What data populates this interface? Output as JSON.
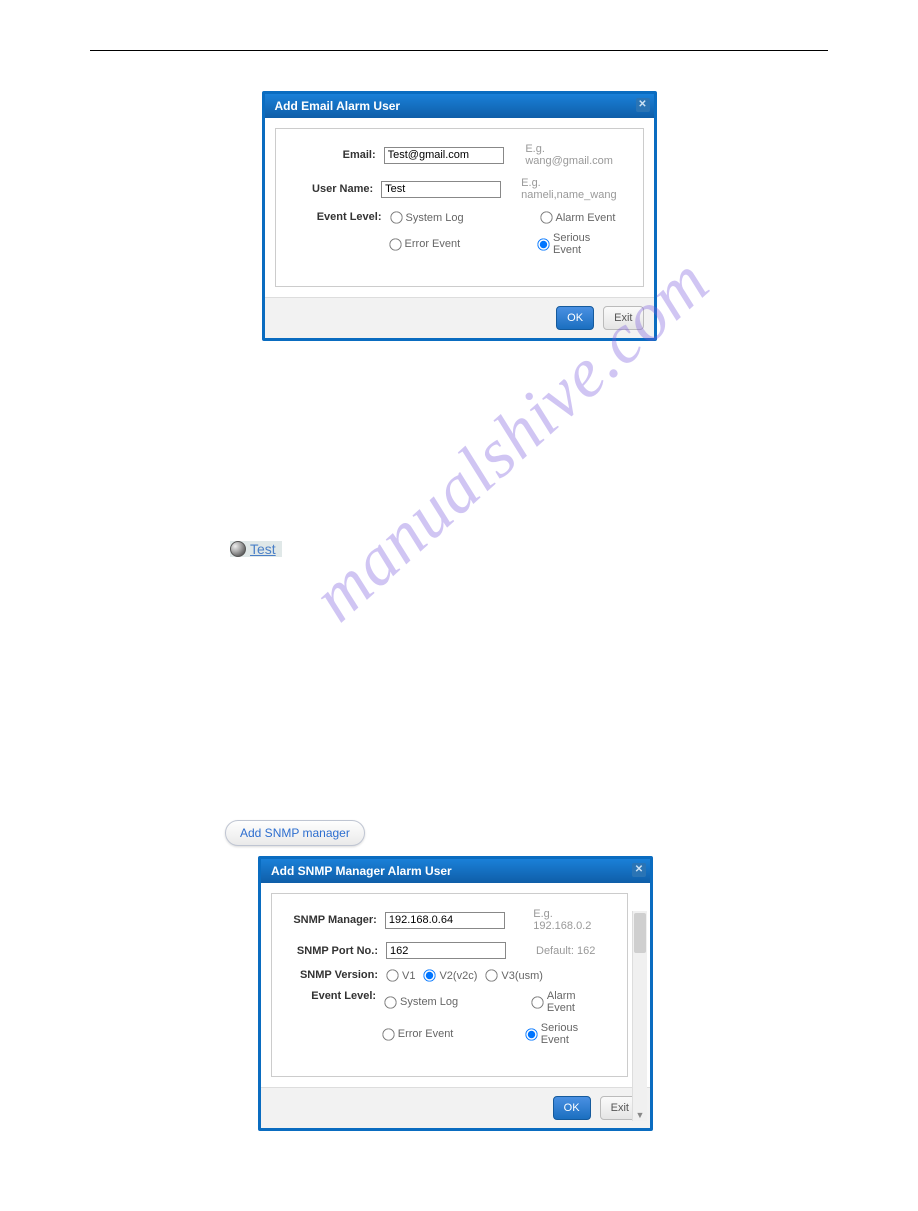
{
  "watermark": "manualshive.com",
  "dialog1": {
    "title": "Add Email Alarm User",
    "email_label": "Email:",
    "email_value": "Test@gmail.com",
    "email_hint": "E.g. wang@gmail.com",
    "username_label": "User Name:",
    "username_value": "Test",
    "username_hint": "E.g. nameli,name_wang",
    "event_label": "Event Level:",
    "opt_systemlog": "System Log",
    "opt_alarm": "Alarm Event",
    "opt_error": "Error Event",
    "opt_serious": "Serious Event",
    "ok": "OK",
    "exit": "Exit"
  },
  "test_link": "Test",
  "pill_button": "Add SNMP manager",
  "dialog2": {
    "title": "Add SNMP Manager Alarm User",
    "manager_label": "SNMP Manager:",
    "manager_value": "192.168.0.64",
    "manager_hint": "E.g. 192.168.0.2",
    "port_label": "SNMP Port No.:",
    "port_value": "162",
    "port_hint": "Default: 162",
    "version_label": "SNMP Version:",
    "opt_v1": "V1",
    "opt_v2": "V2(v2c)",
    "opt_v3": "V3(usm)",
    "event_label": "Event Level:",
    "opt_systemlog": "System Log",
    "opt_alarm": "Alarm Event",
    "opt_error": "Error Event",
    "opt_serious": "Serious Event",
    "ok": "OK",
    "exit": "Exit"
  }
}
